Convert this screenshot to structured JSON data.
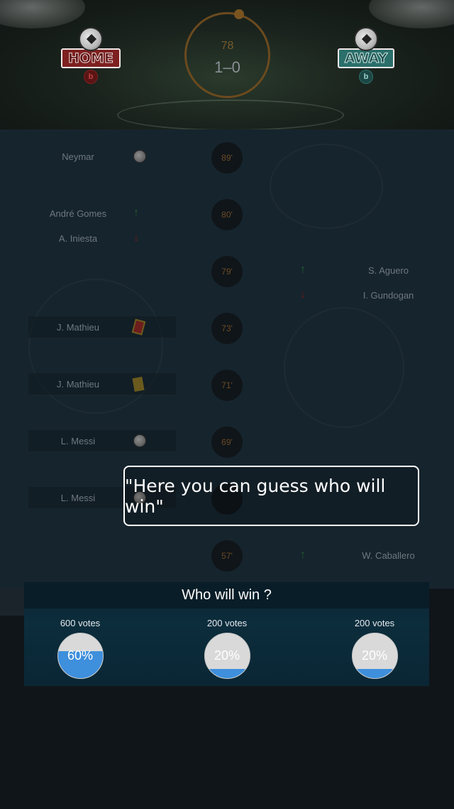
{
  "header": {
    "home_team": {
      "badge_text": "HOME",
      "sub_letter": "b"
    },
    "away_team": {
      "badge_text": "AWAY",
      "sub_letter": "b"
    },
    "minute": "78",
    "score": "1–0"
  },
  "timeline": {
    "events": [
      {
        "minute": "89'",
        "left": [
          {
            "name": "Neymar",
            "icon": "soccer-ball-icon"
          }
        ],
        "right": []
      },
      {
        "minute": "80'",
        "left": [
          {
            "name": "André Gomes",
            "icon": "arrow-up-icon"
          },
          {
            "name": "A. Iniesta",
            "icon": "arrow-down-icon"
          }
        ],
        "right": []
      },
      {
        "minute": "79'",
        "left": [],
        "right": [
          {
            "name": "S. Aguero",
            "icon": "arrow-up-icon"
          },
          {
            "name": "I. Gundogan",
            "icon": "arrow-down-icon"
          }
        ]
      },
      {
        "minute": "73'",
        "left": [
          {
            "name": "J. Mathieu",
            "icon": "red-card-icon"
          }
        ],
        "right": []
      },
      {
        "minute": "71'",
        "left": [
          {
            "name": "J. Mathieu",
            "icon": "yellow-card-icon"
          }
        ],
        "right": []
      },
      {
        "minute": "69'",
        "left": [
          {
            "name": "L. Messi",
            "icon": "soccer-ball-icon"
          }
        ],
        "right": []
      },
      {
        "minute": "",
        "left": [
          {
            "name": "L. Messi",
            "icon": "soccer-ball-icon"
          }
        ],
        "right": []
      },
      {
        "minute": "57'",
        "left": [],
        "right": [
          {
            "name": "W. Caballero",
            "icon": "arrow-up-icon"
          }
        ]
      }
    ]
  },
  "tooltip": {
    "text": "\"Here you can guess who will win\""
  },
  "poll": {
    "title": "Who will win ?",
    "options": [
      {
        "votes": "600 votes",
        "percent_label": "60%",
        "fraction": 0.6
      },
      {
        "votes": "200 votes",
        "percent_label": "20%",
        "fraction": 0.2
      },
      {
        "votes": "200 votes",
        "percent_label": "20%",
        "fraction": 0.2
      }
    ],
    "fill_color": "#3e8fdc"
  }
}
